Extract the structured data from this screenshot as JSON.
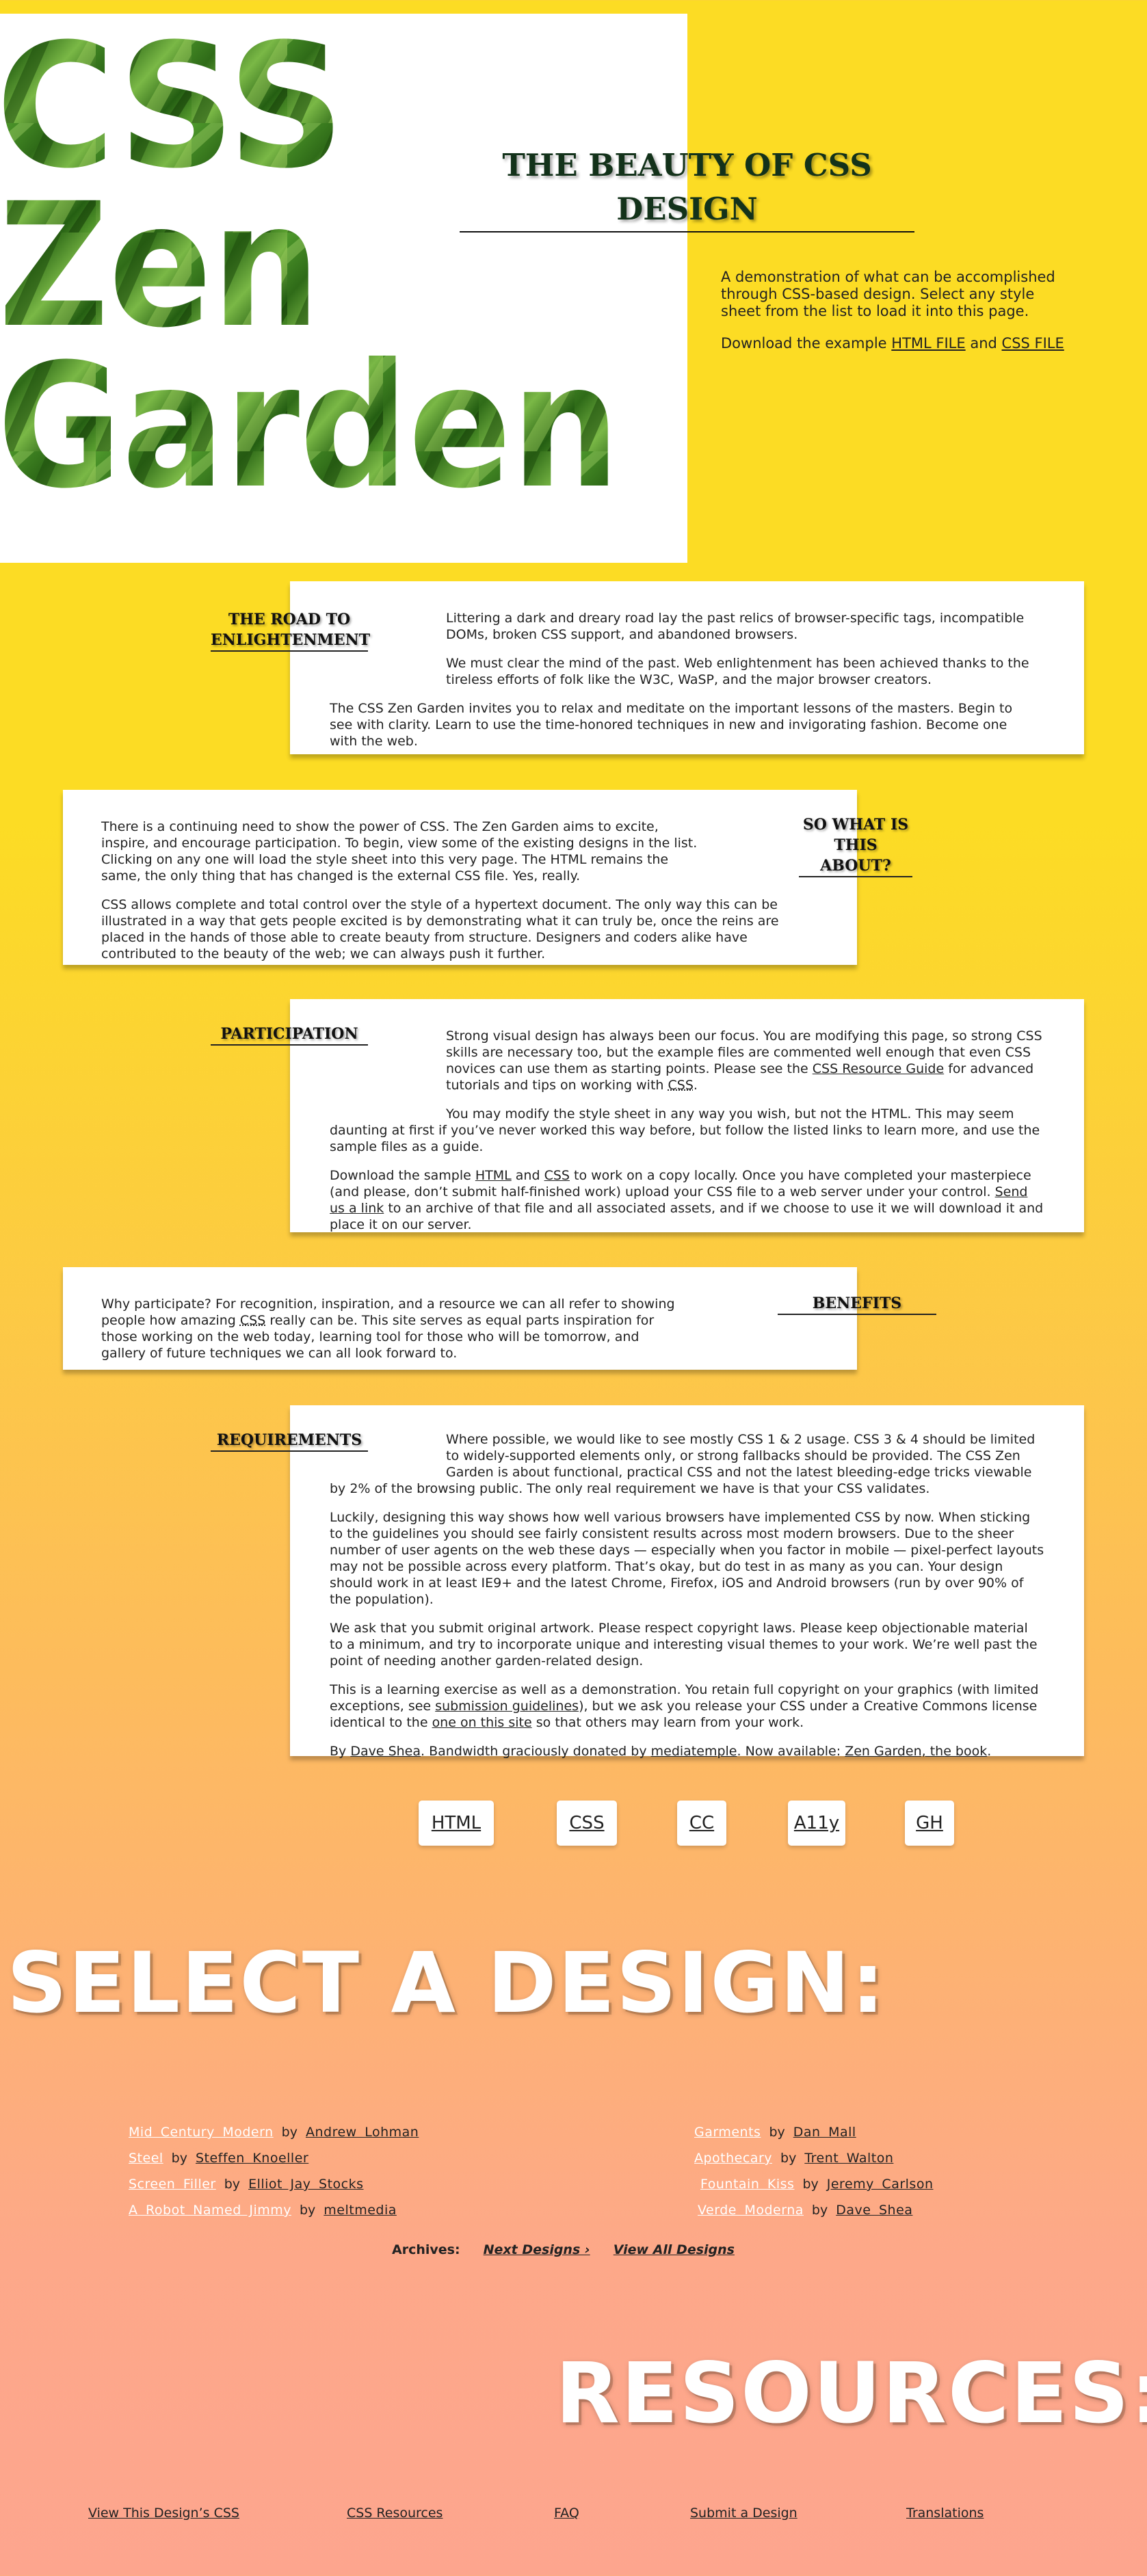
{
  "header": {
    "logo_lines": [
      "CSS",
      "Zen",
      "Garden"
    ],
    "title": "THE BEAUTY OF CSS DESIGN"
  },
  "intro": {
    "description": "A demonstration of what can be accomplished through CSS-based design. Select any style sheet from the list to load it into this page.",
    "download_prefix": "Download the example",
    "html_file_label": "HTML FILE",
    "and": "and",
    "css_file_label": "CSS FILE"
  },
  "sections": {
    "road": {
      "heading": "THE ROAD TO ENLIGHTENMENT",
      "p1": "Littering a dark and dreary road lay the past relics of browser-specific tags, incompatible DOMs, broken CSS support, and abandoned browsers.",
      "p2": "We must clear the mind of the past. Web enlightenment has been achieved thanks to the tireless efforts of folk like the W3C, WaSP, and the major browser creators.",
      "p3": "The CSS Zen Garden invites you to relax and meditate on the important lessons of the masters. Begin to see with clarity. Learn to use the time-honored techniques in new and invigorating fashion. Become one with the web."
    },
    "about": {
      "heading": "SO WHAT IS THIS ABOUT?",
      "p1": "There is a continuing need to show the power of CSS. The Zen Garden aims to excite, inspire, and encourage participation. To begin, view some of the existing designs in the list. Clicking on any one will load the style sheet into this very page. The HTML remains the same, the only thing that has changed is the external CSS file. Yes, really.",
      "p2": "CSS allows complete and total control over the style of a hypertext document. The only way this can be illustrated in a way that gets people excited is by demonstrating what it can truly be, once the reins are placed in the hands of those able to create beauty from structure. Designers and coders alike have contributed to the beauty of the web; we can always push it further."
    },
    "participation": {
      "heading": "PARTICIPATION",
      "p1_a": "Strong visual design has always been our focus. You are modifying this page, so strong CSS skills are necessary too, but the example files are commented well enough that even CSS novices can use them as starting points. Please see the",
      "p1_link": "CSS Resource Guide",
      "p1_b": "for advanced tutorials and tips on working with",
      "p1_abbr": "CSS",
      "p1_c": ".",
      "p2": "You may modify the style sheet in any way you wish, but not the HTML. This may seem daunting at first if you’ve never worked this way before, but follow the listed links to learn more, and use the sample files as a guide.",
      "p3_a": "Download the sample",
      "p3_html": "HTML",
      "p3_and": "and",
      "p3_css": "CSS",
      "p3_b": "to work on a copy locally. Once you have completed your masterpiece (and please, don’t submit half-finished work) upload your CSS file to a web server under your control.",
      "p3_link": "Send us a link",
      "p3_c": "to an archive of that file and all associated assets, and if we choose to use it we will download it and place it on our server."
    },
    "benefits": {
      "heading": "BENEFITS",
      "p1_a": "Why participate? For recognition, inspiration, and a resource we can all refer to showing people how amazing",
      "p1_abbr": "CSS",
      "p1_b": "really can be. This site serves as equal parts inspiration for those working on the web today, learning tool for those who will be tomorrow, and gallery of future techniques we can all look forward to."
    },
    "requirements": {
      "heading": "REQUIREMENTS",
      "p1": "Where possible, we would like to see mostly CSS 1 & 2 usage. CSS 3 & 4 should be limited to widely-supported elements only, or strong fallbacks should be provided. The CSS Zen Garden is about functional, practical CSS and not the latest bleeding-edge tricks viewable by 2% of the browsing public. The only real requirement we have is that your CSS validates.",
      "p2": "Luckily, designing this way shows how well various browsers have implemented CSS by now. When sticking to the guidelines you should see fairly consistent results across most modern browsers. Due to the sheer number of user agents on the web these days — especially when you factor in mobile — pixel-perfect layouts may not be possible across every platform. That’s okay, but do test in as many as you can. Your design should work in at least IE9+ and the latest Chrome, Firefox, iOS and Android browsers (run by over 90% of the population).",
      "p3": "We ask that you submit original artwork. Please respect copyright laws. Please keep objectionable material to a minimum, and try to incorporate unique and interesting visual themes to your work. We’re well past the point of needing another garden-related design.",
      "p4_a": "This is a learning exercise as well as a demonstration. You retain full copyright on your graphics (with limited exceptions, see",
      "p4_link": "submission guidelines",
      "p4_b": "), but we ask you release your CSS under a Creative Commons license identical to the",
      "p4_link2": "one on this site",
      "p4_c": "so that others may learn from your work.",
      "p5_a": "By",
      "p5_link1": "Dave Shea",
      "p5_b": ". Bandwidth graciously donated by",
      "p5_link2": "mediatemple",
      "p5_c": ". Now available:",
      "p5_link3": "Zen Garden, the book",
      "p5_d": "."
    }
  },
  "footer_links": [
    "HTML",
    "CSS",
    "CC",
    "A11y",
    "GH"
  ],
  "select_design": {
    "title": "SELECT A DESIGN:",
    "by": "by",
    "designs": [
      {
        "name": "Mid Century Modern",
        "author": "Andrew Lohman"
      },
      {
        "name": "Steel",
        "author": "Steffen Knoeller"
      },
      {
        "name": "Screen Filler",
        "author": "Elliot Jay Stocks"
      },
      {
        "name": "A Robot Named Jimmy",
        "author": "meltmedia"
      },
      {
        "name": "Garments",
        "author": "Dan Mall"
      },
      {
        "name": "Apothecary",
        "author": "Trent Walton"
      },
      {
        "name": "Fountain Kiss",
        "author": "Jeremy Carlson"
      },
      {
        "name": "Verde Moderna",
        "author": "Dave Shea"
      }
    ],
    "archives_label": "Archives:",
    "next_designs": "Next Designs ›",
    "view_all": "View All Designs"
  },
  "resources": {
    "title": "RESOURCES:",
    "links": [
      "View This Design’s CSS",
      "CSS Resources",
      "FAQ",
      "Submit a Design",
      "Translations"
    ]
  },
  "colors": {
    "background_top": "#fcdc24",
    "background_bottom": "#fda58e",
    "title_green": "#13321a",
    "leaf_green": "#3f8f22"
  },
  "icons": {
    "logo_texture": "leaf-pattern"
  }
}
